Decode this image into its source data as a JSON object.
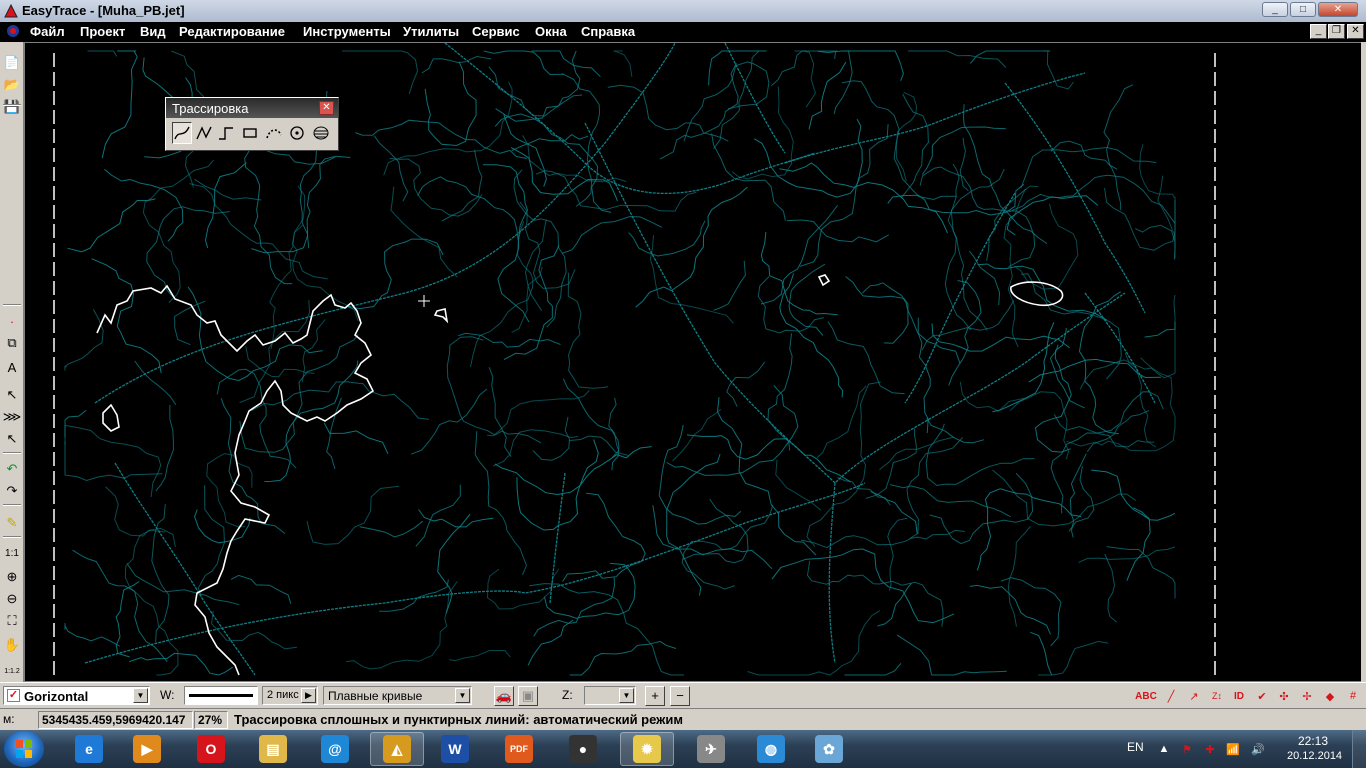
{
  "window": {
    "title": "EasyTrace - [Muha_PB.jet]",
    "buttons": {
      "minimize": "_",
      "maximize": "□",
      "close": "✕"
    }
  },
  "menu": {
    "items": [
      "Файл",
      "Проект",
      "Вид",
      "Редактирование",
      "Инструменты",
      "Утилиты",
      "Сервис",
      "Окна",
      "Справка"
    ],
    "mdi_buttons": {
      "minimize": "_",
      "restore": "❐",
      "close": "✕"
    }
  },
  "left_toolbar": {
    "tools": [
      {
        "name": "new-file-icon",
        "glyph": "📄"
      },
      {
        "name": "open-folder-icon",
        "glyph": "📂"
      },
      {
        "name": "save-icon",
        "glyph": "💾"
      },
      {
        "name": "dot-icon",
        "glyph": "·"
      },
      {
        "name": "layers-icon",
        "glyph": "⧉"
      },
      {
        "name": "text-tool-icon",
        "glyph": "A"
      },
      {
        "name": "select-arrow-icon",
        "glyph": "↖"
      },
      {
        "name": "multi-select-icon",
        "glyph": "⋙"
      },
      {
        "name": "node-select-icon",
        "glyph": "↖"
      },
      {
        "name": "undo-icon",
        "glyph": "↶"
      },
      {
        "name": "redo-icon",
        "glyph": "↷"
      },
      {
        "name": "pencil-icon",
        "glyph": "✎"
      },
      {
        "name": "zoom-1-1",
        "glyph": "1:1"
      },
      {
        "name": "zoom-in-icon",
        "glyph": "⊕"
      },
      {
        "name": "zoom-out-icon",
        "glyph": "⊖"
      },
      {
        "name": "zoom-window-icon",
        "glyph": "⛶"
      },
      {
        "name": "pan-hand-icon",
        "glyph": "✋"
      },
      {
        "name": "scale-ratio",
        "glyph": "1:1.2"
      }
    ]
  },
  "trace_panel": {
    "title": "Трассировка",
    "close": "✕",
    "tools": [
      "smooth-curve-icon",
      "polyline-icon",
      "orthogonal-line-icon",
      "rectangle-icon",
      "dashed-arc-icon",
      "point-target-icon",
      "hatch-icon"
    ]
  },
  "bottom_toolbar": {
    "layer_name": "Gorizontal",
    "w_label": "W:",
    "pixel_width": "2 пикс",
    "curve_mode": "Плавные кривые",
    "z_label": "Z:",
    "z_value": "",
    "plus": "+",
    "minus": "−"
  },
  "status": {
    "m_label": "м:",
    "coordinates": "5345435.459,5969420.147",
    "zoom": "27%",
    "message": "Трассировка сплошных и пунктирных линий: автоматический режим"
  },
  "taskbar": {
    "apps": [
      {
        "name": "ie-app",
        "color": "#1e7ad6",
        "glyph": "e",
        "active": false
      },
      {
        "name": "media-player-app",
        "color": "#e08a1e",
        "glyph": "▶",
        "active": false
      },
      {
        "name": "opera-app",
        "color": "#d6141c",
        "glyph": "O",
        "active": false
      },
      {
        "name": "explorer-app",
        "color": "#e0b84a",
        "glyph": "▤",
        "active": false
      },
      {
        "name": "mail-app",
        "color": "#1e88d6",
        "glyph": "@",
        "active": false
      },
      {
        "name": "easytrace-app",
        "color": "#d69a1e",
        "glyph": "◭",
        "active": true
      },
      {
        "name": "word-app",
        "color": "#1e4fa6",
        "glyph": "W",
        "active": false
      },
      {
        "name": "pdf-app",
        "color": "#e05a1e",
        "glyph": "PDF",
        "active": false
      },
      {
        "name": "camera-app",
        "color": "#333333",
        "glyph": "●",
        "active": false
      },
      {
        "name": "bulb-app",
        "color": "#e6c84a",
        "glyph": "✹",
        "active": true
      },
      {
        "name": "paper-plane-app",
        "color": "#888888",
        "glyph": "✈",
        "active": false
      },
      {
        "name": "globe-app",
        "color": "#2a8ad6",
        "glyph": "◍",
        "active": false
      },
      {
        "name": "paint-app",
        "color": "#6aa6d6",
        "glyph": "✿",
        "active": false
      }
    ],
    "language": "EN",
    "time": "22:13",
    "date": "20.12.2014"
  },
  "colors": {
    "contour": "#0e7f86",
    "selected_contour": "#ffffff",
    "frame_line": "#ffffff"
  }
}
